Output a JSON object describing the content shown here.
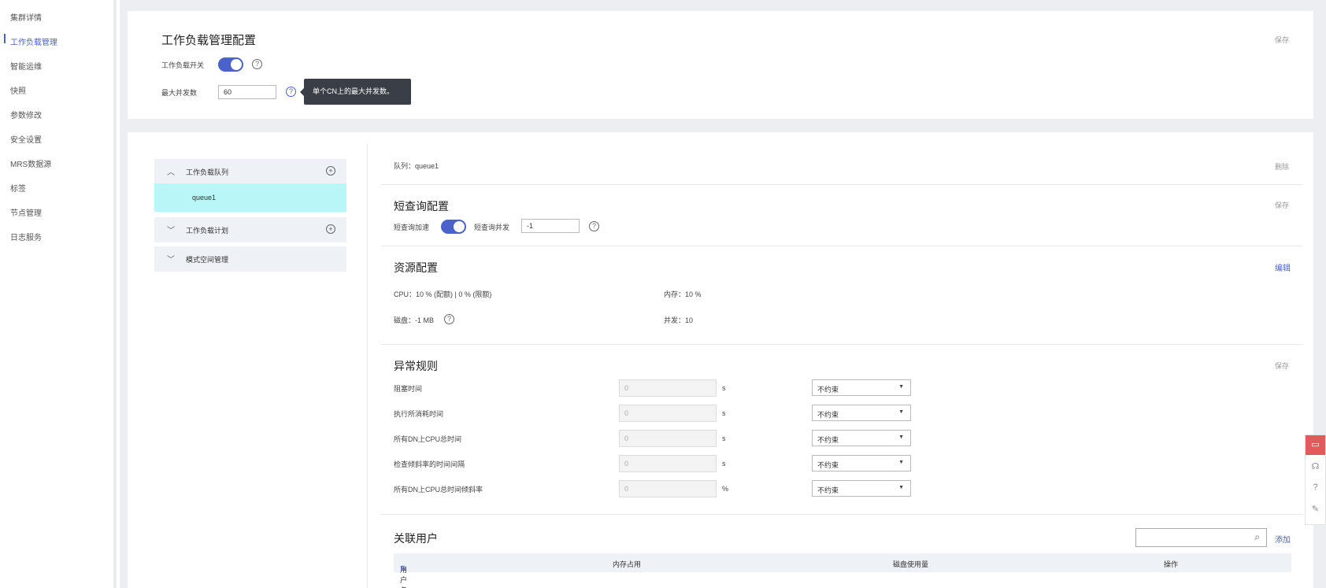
{
  "sidebar": {
    "items": [
      {
        "label": "集群详情",
        "active": false
      },
      {
        "label": "工作负载管理",
        "active": true
      },
      {
        "label": "智能运维",
        "active": false
      },
      {
        "label": "快照",
        "active": false
      },
      {
        "label": "参数修改",
        "active": false
      },
      {
        "label": "安全设置",
        "active": false
      },
      {
        "label": "MRS数据源",
        "active": false
      },
      {
        "label": "标签",
        "active": false
      },
      {
        "label": "节点管理",
        "active": false
      },
      {
        "label": "日志服务",
        "active": false
      }
    ]
  },
  "top_card": {
    "title": "工作负载管理配置",
    "save_label": "保存",
    "switch_label": "工作负载开关",
    "switch_on": true,
    "max_concurrency_label": "最大并发数",
    "max_concurrency_value": "60",
    "tooltip": "单个CN上的最大并发数。"
  },
  "accordion": {
    "queue_header": "工作负载队列",
    "queue_item": "queue1",
    "plan_header": "工作负载计划",
    "space_header": "模式空间管理"
  },
  "queue": {
    "label": "队列：",
    "name": "queue1",
    "delete_label": "删除"
  },
  "short_query": {
    "title": "短查询配置",
    "save_label": "保存",
    "accel_label": "短查询加速",
    "accel_on": true,
    "concurrency_label": "短查询并发",
    "concurrency_value": "-1"
  },
  "resource": {
    "title": "资源配置",
    "edit_label": "编辑",
    "cpu": "CPU：10 % (配额) | 0 % (限额)",
    "memory": "内存：10 %",
    "disk": "磁盘：-1 MB",
    "concurrency": "并发：10"
  },
  "exception": {
    "title": "异常规则",
    "save_label": "保存",
    "rules": [
      {
        "label": "阻塞时间",
        "value": "0",
        "unit": "s",
        "action": "不约束"
      },
      {
        "label": "执行所消耗时间",
        "value": "0",
        "unit": "s",
        "action": "不约束"
      },
      {
        "label": "所有DN上CPU总时间",
        "value": "0",
        "unit": "s",
        "action": "不约束"
      },
      {
        "label": "检查倾斜率的时间间隔",
        "value": "0",
        "unit": "s",
        "action": "不约束"
      },
      {
        "label": "所有DN上CPU总时间倾斜率",
        "value": "0",
        "unit": "%",
        "action": "不约束"
      }
    ]
  },
  "users": {
    "title": "关联用户",
    "add_label": "添加",
    "search_placeholder": "",
    "columns": [
      "用户名",
      "内存占用",
      "磁盘使用量",
      "操作"
    ]
  },
  "colors": {
    "accent": "#4a62c9",
    "highlight": "#b9f6f7",
    "float_red": "#e35a5a"
  }
}
